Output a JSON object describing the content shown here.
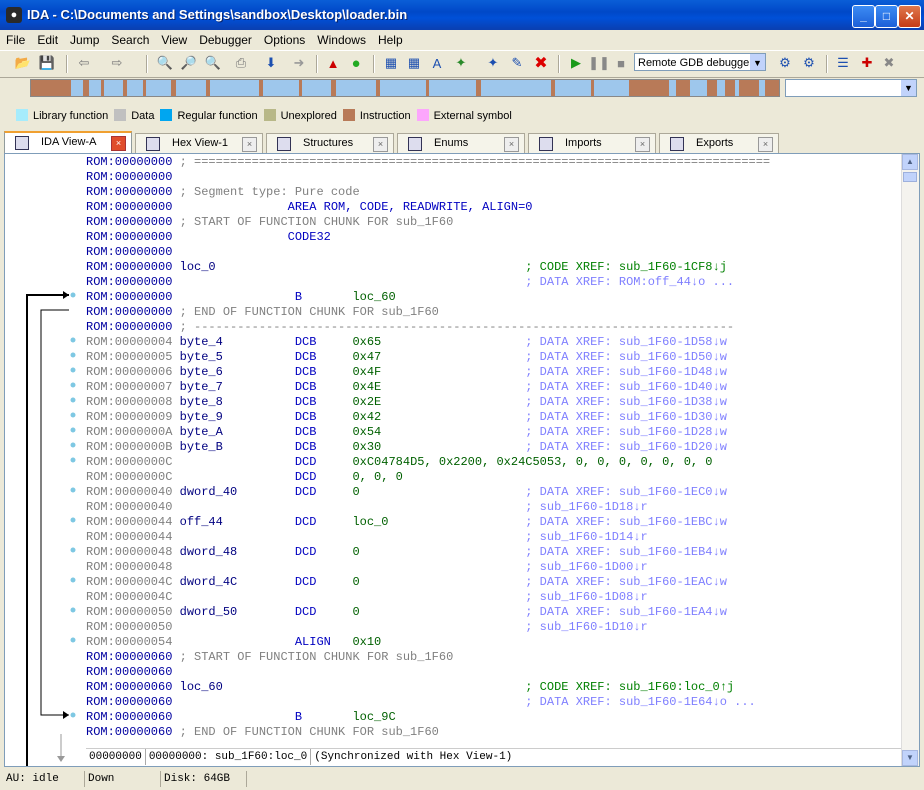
{
  "window": {
    "title": "IDA - C:\\Documents and Settings\\sandbox\\Desktop\\loader.bin"
  },
  "menu": [
    "File",
    "Edit",
    "Jump",
    "Search",
    "View",
    "Debugger",
    "Options",
    "Windows",
    "Help"
  ],
  "debugger_select": "Remote GDB debugger",
  "legend": [
    {
      "label": "Library function",
      "color": "#a6ecfc"
    },
    {
      "label": "Data",
      "color": "#c0c0c0"
    },
    {
      "label": "Regular function",
      "color": "#00a6f0"
    },
    {
      "label": "Unexplored",
      "color": "#b8b888"
    },
    {
      "label": "Instruction",
      "color": "#b87a58"
    },
    {
      "label": "External symbol",
      "color": "#fca6fc"
    }
  ],
  "tabs": [
    {
      "label": "IDA View-A",
      "active": true
    },
    {
      "label": "Hex View-1"
    },
    {
      "label": "Structures"
    },
    {
      "label": "Enums"
    },
    {
      "label": "Imports"
    },
    {
      "label": "Exports"
    }
  ],
  "listing": [
    {
      "a": "ROM:00000000",
      "b": " ; ================================================================================",
      "c": "sep"
    },
    {
      "a": "ROM:00000000",
      "b": ""
    },
    {
      "a": "ROM:00000000",
      "b": " ; Segment type: Pure code",
      "c": "cmt"
    },
    {
      "a": "ROM:00000000",
      "b": "                AREA ROM, CODE, READWRITE, ALIGN=0",
      "c": "ins"
    },
    {
      "a": "ROM:00000000",
      "b": " ; START OF FUNCTION CHUNK FOR sub_1F60",
      "c": "cmt"
    },
    {
      "a": "ROM:00000000",
      "b": "                CODE32",
      "c": "ins"
    },
    {
      "a": "ROM:00000000",
      "b": ""
    },
    {
      "a": "ROM:00000000",
      "l": "loc_0",
      "x": "; CODE XREF: sub_1F60-1CF8↓j",
      "xc": "xg"
    },
    {
      "a": "ROM:00000000",
      "x": "; DATA XREF: ROM:off_44↓o ...",
      "xc": "xb"
    },
    {
      "a": "ROM:00000000",
      "i": "B",
      "o": "loc_60"
    },
    {
      "a": "ROM:00000000",
      "b": " ; END OF FUNCTION CHUNK FOR sub_1F60",
      "c": "cmt"
    },
    {
      "a": "ROM:00000000",
      "b": " ; ---------------------------------------------------------------------------",
      "c": "cmt"
    },
    {
      "a": "ROM:00000004",
      "d": 1,
      "l": "byte_4",
      "i": "DCB",
      "o": "0x65",
      "x": "; DATA XREF: sub_1F60-1D58↓w",
      "xc": "xb"
    },
    {
      "a": "ROM:00000005",
      "d": 1,
      "l": "byte_5",
      "i": "DCB",
      "o": "0x47",
      "x": "; DATA XREF: sub_1F60-1D50↓w",
      "xc": "xb"
    },
    {
      "a": "ROM:00000006",
      "d": 1,
      "l": "byte_6",
      "i": "DCB",
      "o": "0x4F",
      "x": "; DATA XREF: sub_1F60-1D48↓w",
      "xc": "xb"
    },
    {
      "a": "ROM:00000007",
      "d": 1,
      "l": "byte_7",
      "i": "DCB",
      "o": "0x4E",
      "x": "; DATA XREF: sub_1F60-1D40↓w",
      "xc": "xb"
    },
    {
      "a": "ROM:00000008",
      "d": 1,
      "l": "byte_8",
      "i": "DCB",
      "o": "0x2E",
      "x": "; DATA XREF: sub_1F60-1D38↓w",
      "xc": "xb"
    },
    {
      "a": "ROM:00000009",
      "d": 1,
      "l": "byte_9",
      "i": "DCB",
      "o": "0x42",
      "x": "; DATA XREF: sub_1F60-1D30↓w",
      "xc": "xb"
    },
    {
      "a": "ROM:0000000A",
      "d": 1,
      "l": "byte_A",
      "i": "DCB",
      "o": "0x54",
      "x": "; DATA XREF: sub_1F60-1D28↓w",
      "xc": "xb"
    },
    {
      "a": "ROM:0000000B",
      "d": 1,
      "l": "byte_B",
      "i": "DCB",
      "o": "0x30",
      "x": "; DATA XREF: sub_1F60-1D20↓w",
      "xc": "xb"
    },
    {
      "a": "ROM:0000000C",
      "d": 1,
      "i": "DCD",
      "o": "0xC04784D5, 0x2200, 0x24C5053, 0, 0, 0, 0, 0, 0, 0"
    },
    {
      "a": "ROM:0000000C",
      "d": 1,
      "i": "DCD",
      "o": "0, 0, 0"
    },
    {
      "a": "ROM:00000040",
      "d": 1,
      "l": "dword_40",
      "i": "DCD",
      "o": "0",
      "x": "; DATA XREF: sub_1F60-1EC0↓w",
      "xc": "xb"
    },
    {
      "a": "ROM:00000040",
      "d": 1,
      "x": "; sub_1F60-1D18↓r",
      "xc": "xb"
    },
    {
      "a": "ROM:00000044",
      "d": 1,
      "l": "off_44",
      "i": "DCD",
      "o": "loc_0",
      "x": "; DATA XREF: sub_1F60-1EBC↓w",
      "xc": "xb"
    },
    {
      "a": "ROM:00000044",
      "d": 1,
      "x": "; sub_1F60-1D14↓r",
      "xc": "xb"
    },
    {
      "a": "ROM:00000048",
      "d": 1,
      "l": "dword_48",
      "i": "DCD",
      "o": "0",
      "x": "; DATA XREF: sub_1F60-1EB4↓w",
      "xc": "xb"
    },
    {
      "a": "ROM:00000048",
      "d": 1,
      "x": "; sub_1F60-1D00↓r",
      "xc": "xb"
    },
    {
      "a": "ROM:0000004C",
      "d": 1,
      "l": "dword_4C",
      "i": "DCD",
      "o": "0",
      "x": "; DATA XREF: sub_1F60-1EAC↓w",
      "xc": "xb"
    },
    {
      "a": "ROM:0000004C",
      "d": 1,
      "x": "; sub_1F60-1D08↓r",
      "xc": "xb"
    },
    {
      "a": "ROM:00000050",
      "d": 1,
      "l": "dword_50",
      "i": "DCD",
      "o": "0",
      "x": "; DATA XREF: sub_1F60-1EA4↓w",
      "xc": "xb"
    },
    {
      "a": "ROM:00000050",
      "d": 1,
      "x": "; sub_1F60-1D10↓r",
      "xc": "xb"
    },
    {
      "a": "ROM:00000054",
      "d": 1,
      "i": "ALIGN",
      "o": "0x10"
    },
    {
      "a": "ROM:00000060",
      "b": " ; START OF FUNCTION CHUNK FOR sub_1F60",
      "c": "cmt"
    },
    {
      "a": "ROM:00000060",
      "b": ""
    },
    {
      "a": "ROM:00000060",
      "l": "loc_60",
      "x": "; CODE XREF: sub_1F60:loc_0↑j",
      "xc": "xg"
    },
    {
      "a": "ROM:00000060",
      "x": "; DATA XREF: sub_1F60-1E64↓o ...",
      "xc": "xb"
    },
    {
      "a": "ROM:00000060",
      "i": "B",
      "o": "loc_9C"
    },
    {
      "a": "ROM:00000060",
      "b": " ; END OF FUNCTION CHUNK FOR sub_1F60",
      "c": "cmt"
    }
  ],
  "sync_status": {
    "offset": "00000000",
    "location": "00000000: sub_1F60:loc_0",
    "note": "(Synchronized with Hex View-1)"
  },
  "statusbar": {
    "au": "AU:  idle",
    "dir": "Down",
    "disk": "Disk: 64GB"
  }
}
